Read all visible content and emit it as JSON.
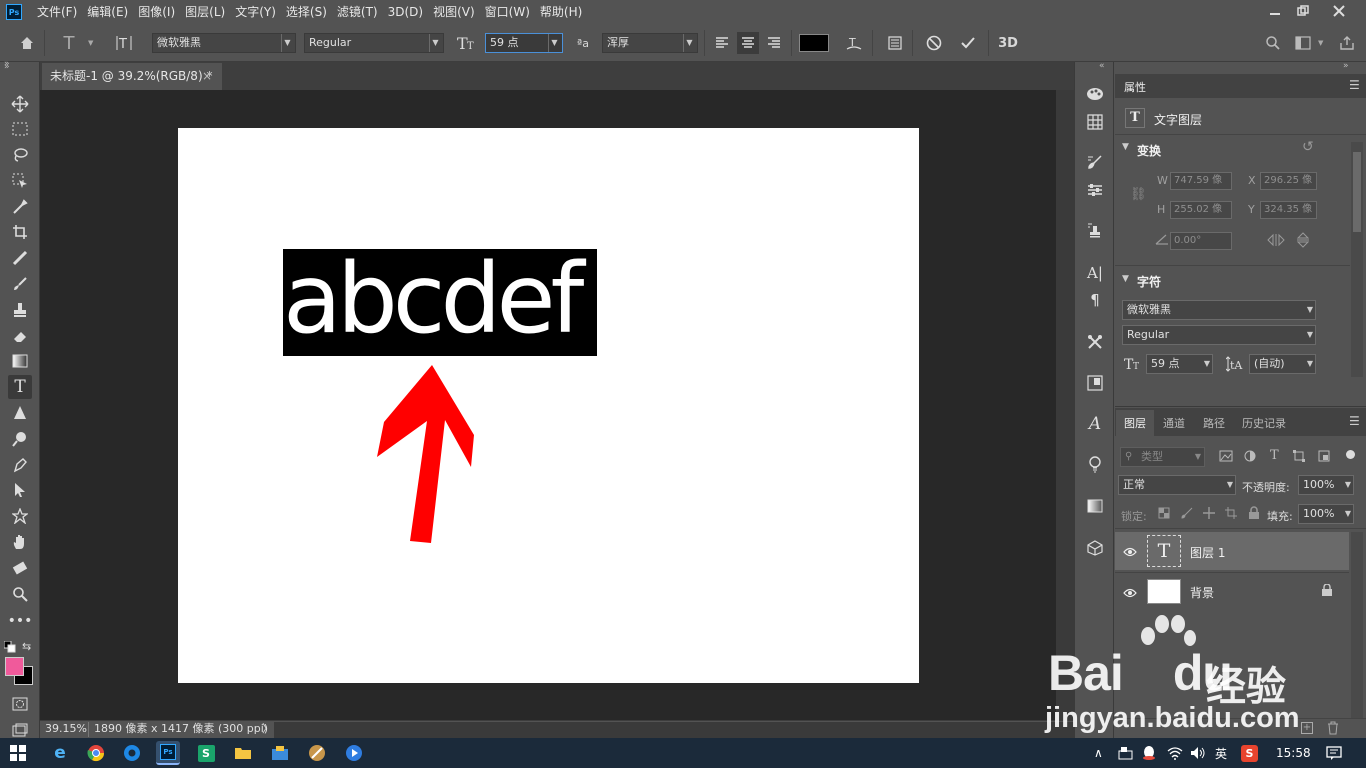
{
  "menubar": {
    "logo": "Ps",
    "items": [
      "文件(F)",
      "编辑(E)",
      "图像(I)",
      "图层(L)",
      "文字(Y)",
      "选择(S)",
      "滤镜(T)",
      "3D(D)",
      "视图(V)",
      "窗口(W)",
      "帮助(H)"
    ]
  },
  "options": {
    "font_family": "微软雅黑",
    "font_style": "Regular",
    "font_size": "59 点",
    "aa_label": "ªa",
    "antialias": "浑厚",
    "threed": "3D"
  },
  "document": {
    "tab_title": "未标题-1 @ 39.2%(RGB/8) *",
    "close": "×",
    "text_content": "abcdef",
    "text_color": "#ffffff",
    "highlight_color": "#000000",
    "arrow_color": "#ff0000"
  },
  "status": {
    "zoom": "39.15%",
    "info": "1890 像素 x 1417 像素 (300 ppi)",
    "chevron": "〉"
  },
  "colors": {
    "foreground": "#f05a9b",
    "background": "#000000"
  },
  "properties": {
    "title": "属性",
    "layer_type": "文字图层",
    "transform_title": "变换",
    "w_label": "W",
    "w_value": "747.59 像",
    "x_label": "X",
    "x_value": "296.25 像",
    "h_label": "H",
    "h_value": "255.02 像",
    "y_label": "Y",
    "y_value": "324.35 像",
    "angle_value": "0.00°",
    "char_title": "字符",
    "char_font": "微软雅黑",
    "char_style": "Regular",
    "char_size": "59 点",
    "char_leading": "(自动)"
  },
  "layers_panel": {
    "tabs": [
      "图层",
      "通道",
      "路径",
      "历史记录"
    ],
    "filter_placeholder": "类型",
    "blend_mode": "正常",
    "opacity_label": "不透明度:",
    "opacity_value": "100%",
    "lock_label": "锁定:",
    "fill_label": "填充:",
    "fill_value": "100%",
    "layers": [
      {
        "name": "图层 1"
      },
      {
        "name": "背景"
      }
    ]
  },
  "watermark": {
    "brand": "Bai",
    "brand2": "du",
    "cn": "经验",
    "url": "jingyan.baidu.com"
  },
  "taskbar": {
    "ime": "英",
    "time": "15:58"
  }
}
